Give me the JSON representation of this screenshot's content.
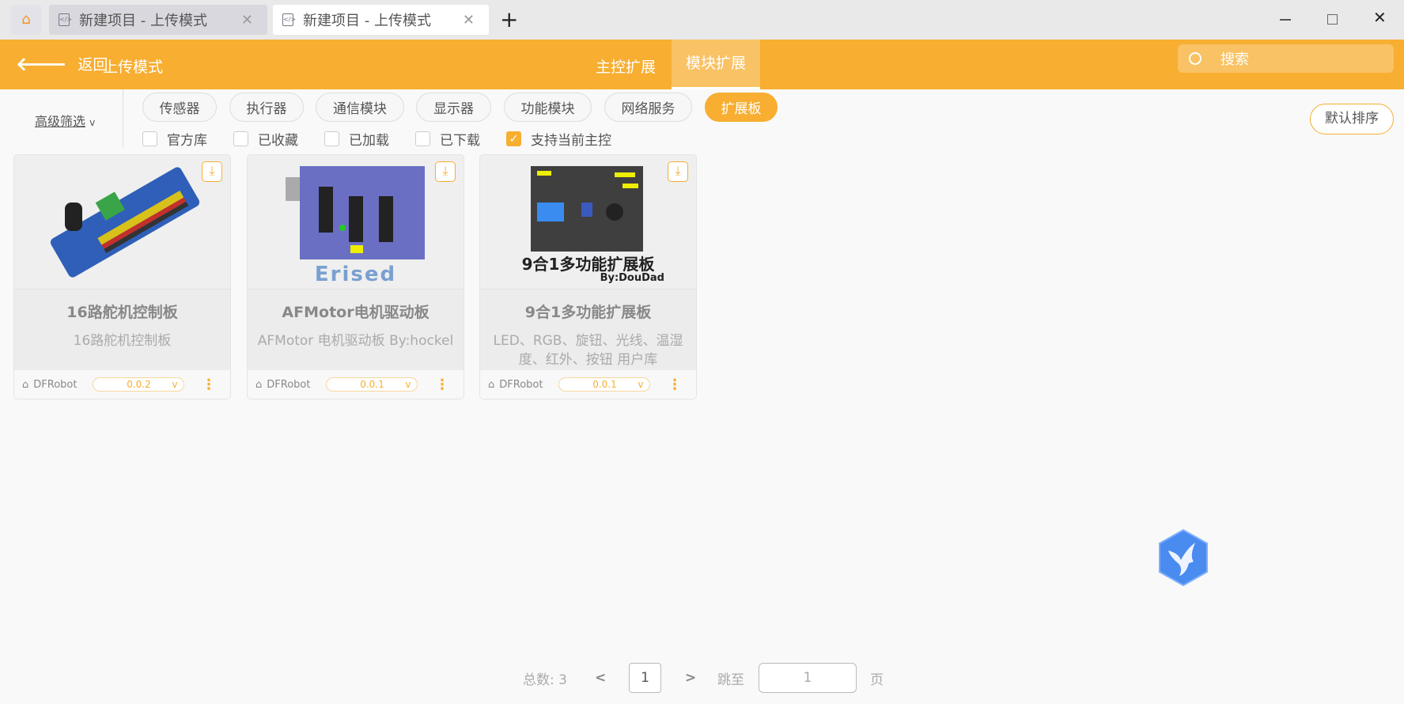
{
  "tabs": [
    {
      "title": "新建项目 - 上传模式"
    },
    {
      "title": "新建项目 - 上传模式"
    }
  ],
  "header": {
    "back": "返回",
    "mode": "上传模式",
    "nav": [
      "主控扩展",
      "模块扩展"
    ],
    "active_nav": "模块扩展",
    "search_placeholder": "搜索"
  },
  "filters": {
    "advanced": "高级筛选",
    "categories": [
      "传感器",
      "执行器",
      "通信模块",
      "显示器",
      "功能模块",
      "网络服务",
      "扩展板"
    ],
    "active_category": "扩展板",
    "checkboxes": [
      {
        "label": "官方库",
        "checked": false
      },
      {
        "label": "已收藏",
        "checked": false
      },
      {
        "label": "已加载",
        "checked": false
      },
      {
        "label": "已下载",
        "checked": false
      },
      {
        "label": "支持当前主控",
        "checked": true
      }
    ],
    "sort": "默认排序"
  },
  "cards": [
    {
      "title": "16路舵机控制板",
      "desc": "16路舵机控制板",
      "author": "DFRobot",
      "version": "0.0.2"
    },
    {
      "title": "AFMotor电机驱动板",
      "desc": "AFMotor 电机驱动板 By:hockel",
      "author": "DFRobot",
      "version": "0.0.1",
      "image_caption": "Erised"
    },
    {
      "title": "9合1多功能扩展板",
      "desc": "LED、RGB、旋钮、光线、温湿度、红外、按钮 用户库 By:Dou...",
      "author": "DFRobot",
      "version": "0.0.1",
      "image_caption": "9合1多功能扩展板",
      "image_sub": "By:DouDad"
    }
  ],
  "pagination": {
    "total_label": "总数: 3",
    "page": "1",
    "jump_label": "跳至",
    "jump_value": "1",
    "page_unit": "页"
  },
  "colors": {
    "accent": "#f7ae31",
    "assistant": "#4a8bf0"
  }
}
